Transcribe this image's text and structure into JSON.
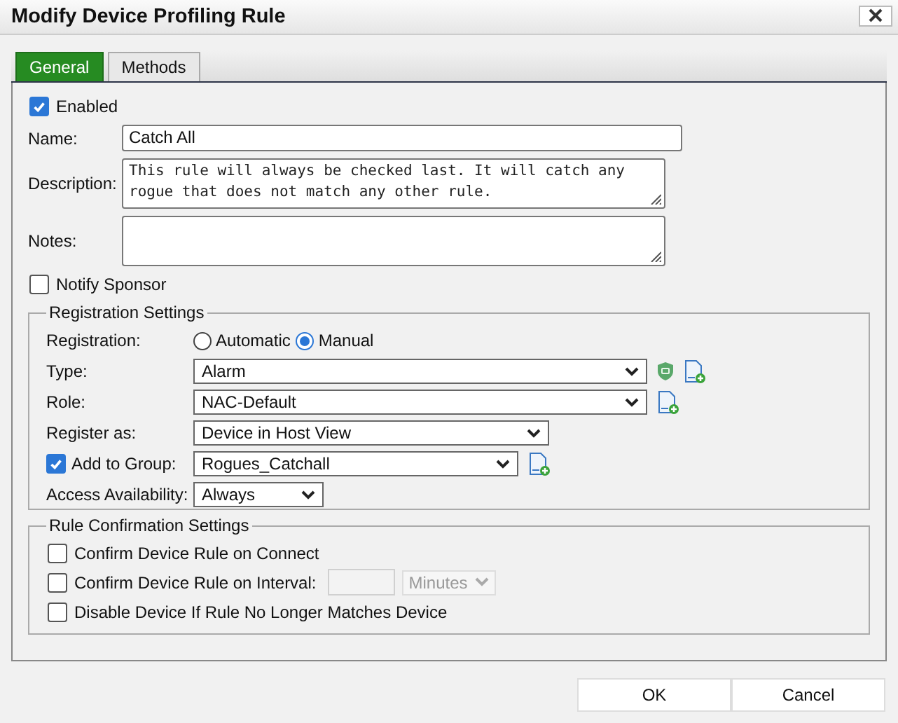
{
  "window": {
    "title": "Modify Device Profiling Rule"
  },
  "tabs": [
    {
      "label": "General",
      "selected": true
    },
    {
      "label": "Methods",
      "selected": false
    }
  ],
  "enabled": {
    "label": "Enabled",
    "checked": true
  },
  "fields": [
    {
      "kind": "input",
      "label": "Name:",
      "value": "Catch All"
    },
    {
      "kind": "textarea",
      "label": "Description:",
      "value": "This rule will always be checked last. It will catch any rogue that does not match any other rule."
    },
    {
      "kind": "textarea",
      "label": "Notes:"
    }
  ],
  "notify_sponsor": {
    "label": "Notify Sponsor",
    "checked": false
  },
  "registration_settings": {
    "legend": "Registration Settings",
    "rows": [
      {
        "kind": "radio",
        "label": "Registration:",
        "options": [
          {
            "label": "Automatic",
            "selected": false
          },
          {
            "label": "Manual",
            "selected": true
          }
        ]
      },
      {
        "kind": "select",
        "label": "Type:",
        "value": "Alarm"
      },
      {
        "kind": "select",
        "label": "Role:",
        "value": "NAC-Default"
      },
      {
        "kind": "select",
        "label": "Register as:",
        "value": "Device in Host View"
      },
      {
        "kind": "check-select",
        "label": "Add to Group:",
        "checked": true,
        "value": "Rogues_Catchall"
      },
      {
        "kind": "select",
        "label": "Access Availability:",
        "value": "Always"
      }
    ]
  },
  "rule_confirmation_settings": {
    "legend": "Rule Confirmation Settings",
    "items": [
      {
        "kind": "checkbox",
        "label": "Confirm Device Rule on Connect",
        "checked": false
      },
      {
        "kind": "interval",
        "label": "Confirm Device Rule on Interval:",
        "checked": false,
        "disabled": true,
        "unit": "Minutes"
      },
      {
        "kind": "checkbox",
        "label": "Disable Device If Rule No Longer Matches Device",
        "checked": false
      }
    ]
  },
  "buttons": [
    "OK",
    "Cancel"
  ]
}
